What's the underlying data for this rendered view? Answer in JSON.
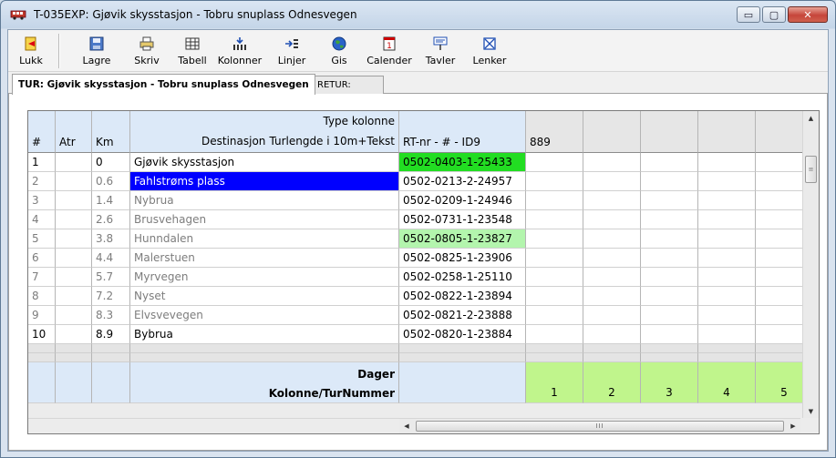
{
  "window": {
    "title": "T-035EXP: Gjøvik skysstasjon - Tobru snuplass Odnesvegen",
    "controls": {
      "minimize": "▭",
      "maximize": "▢",
      "close": "✕"
    }
  },
  "toolbar": {
    "lukk": "Lukk",
    "lagre": "Lagre",
    "skriv": "Skriv",
    "tabell": "Tabell",
    "kolonner": "Kolonner",
    "linjer": "Linjer",
    "gis": "Gis",
    "calender": "Calender",
    "tavler": "Tavler",
    "lenker": "Lenker"
  },
  "tabs": {
    "tur": "TUR: Gjøvik skysstasjon - Tobru snuplass Odnesvegen",
    "retur": "RETUR:"
  },
  "grid": {
    "header": {
      "num": "#",
      "atr": "Atr",
      "km": "Km",
      "type_kolonne": "Type kolonne",
      "destinasjon": "Destinasjon",
      "turlengde": "Turlengde i 10m+Tekst",
      "rtnr": "RT-nr - # - ID9",
      "col889": "889"
    },
    "rows": [
      {
        "num": "1",
        "km": "0",
        "dest": "Gjøvik skysstasjon",
        "rt": "0502-0403-1-25433"
      },
      {
        "num": "2",
        "km": "0.6",
        "dest": "Fahlstrøms plass",
        "rt": "0502-0213-2-24957"
      },
      {
        "num": "3",
        "km": "1.4",
        "dest": "Nybrua",
        "rt": "0502-0209-1-24946"
      },
      {
        "num": "4",
        "km": "2.6",
        "dest": "Brusvehagen",
        "rt": "0502-0731-1-23548"
      },
      {
        "num": "5",
        "km": "3.8",
        "dest": "Hunndalen",
        "rt": "0502-0805-1-23827"
      },
      {
        "num": "6",
        "km": "4.4",
        "dest": "Malerstuen",
        "rt": "0502-0825-1-23906"
      },
      {
        "num": "7",
        "km": "5.7",
        "dest": "Myrvegen",
        "rt": "0502-0258-1-25110"
      },
      {
        "num": "8",
        "km": "7.2",
        "dest": "Nyset",
        "rt": "0502-0822-1-23894"
      },
      {
        "num": "9",
        "km": "8.3",
        "dest": "Elvsvevegen",
        "rt": "0502-0821-2-23888"
      },
      {
        "num": "10",
        "km": "8.9",
        "dest": "Bybrua",
        "rt": "0502-0820-1-23884"
      }
    ],
    "footer": {
      "dager": "Dager",
      "kolonne": "Kolonne/TurNummer",
      "numbers": [
        "1",
        "2",
        "3",
        "4",
        "5"
      ]
    },
    "hscroll_grip": "III"
  },
  "colors": {
    "header_blue": "#dce9f8",
    "green_strong": "#22dd22",
    "green_light": "#b3f5ad",
    "selection_blue": "#0000ff",
    "footer_green": "#c0f58c"
  }
}
